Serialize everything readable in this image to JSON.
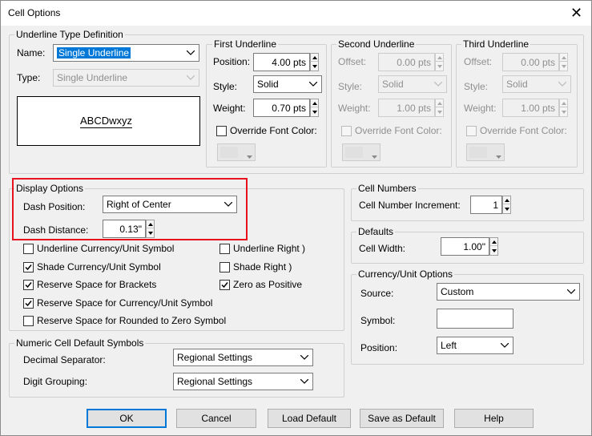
{
  "window": {
    "title": "Cell Options",
    "close_glyph": "✕"
  },
  "underline_type": {
    "group_label": "Underline Type Definition",
    "name_label": "Name:",
    "name_value": "Single Underline",
    "type_label": "Type:",
    "type_value": "Single Underline",
    "preview_text": "ABCDwxyz"
  },
  "first_underline": {
    "label": "First Underline",
    "position_label": "Position:",
    "position_value": "4.00 pts",
    "style_label": "Style:",
    "style_value": "Solid",
    "weight_label": "Weight:",
    "weight_value": "0.70 pts",
    "override_label": "Override Font Color:"
  },
  "second_underline": {
    "label": "Second Underline",
    "offset_label": "Offset:",
    "offset_value": "0.00 pts",
    "style_label": "Style:",
    "style_value": "Solid",
    "weight_label": "Weight:",
    "weight_value": "1.00 pts",
    "override_label": "Override Font Color:"
  },
  "third_underline": {
    "label": "Third Underline",
    "offset_label": "Offset:",
    "offset_value": "0.00 pts",
    "style_label": "Style:",
    "style_value": "Solid",
    "weight_label": "Weight:",
    "weight_value": "1.00 pts",
    "override_label": "Override Font Color:"
  },
  "display_options": {
    "group_label": "Display Options",
    "dash_position_label": "Dash Position:",
    "dash_position_value": "Right of Center",
    "dash_distance_label": "Dash Distance:",
    "dash_distance_value": "0.13\"",
    "checkboxes": {
      "underline_currency": "Underline Currency/Unit Symbol",
      "shade_currency": "Shade Currency/Unit Symbol",
      "reserve_brackets": "Reserve Space for Brackets",
      "reserve_currency": "Reserve Space for Currency/Unit Symbol",
      "reserve_rounded": "Reserve Space for Rounded to Zero Symbol",
      "underline_right": "Underline Right )",
      "shade_right": "Shade Right )",
      "zero_positive": "Zero as Positive"
    }
  },
  "numeric_defaults": {
    "group_label": "Numeric Cell Default Symbols",
    "decimal_label": "Decimal Separator:",
    "decimal_value": "Regional Settings",
    "digit_label": "Digit Grouping:",
    "digit_value": "Regional Settings"
  },
  "cell_numbers": {
    "group_label": "Cell Numbers",
    "increment_label": "Cell Number Increment:",
    "increment_value": "1"
  },
  "defaults": {
    "group_label": "Defaults",
    "width_label": "Cell Width:",
    "width_value": "1.00\""
  },
  "currency_options": {
    "group_label": "Currency/Unit Options",
    "source_label": "Source:",
    "source_value": "Custom",
    "symbol_label": "Symbol:",
    "symbol_value": "",
    "position_label": "Position:",
    "position_value": "Left"
  },
  "buttons": {
    "ok": "OK",
    "cancel": "Cancel",
    "load_default": "Load Default",
    "save_default": "Save as Default",
    "help": "Help"
  },
  "colors": {
    "accent": "#0078d7",
    "highlight_box": "#e8121e"
  }
}
